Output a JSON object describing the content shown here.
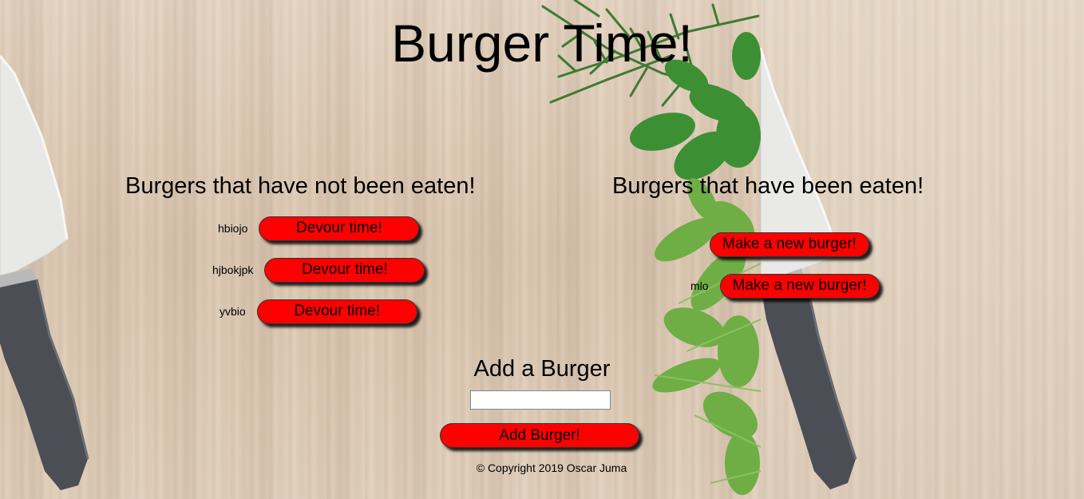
{
  "page": {
    "title": "Burger Time!"
  },
  "uneaten": {
    "heading": "Burgers that have not been eaten!",
    "items": [
      {
        "name": "hbiojo",
        "button": "Devour time!"
      },
      {
        "name": "hjbokjpk",
        "button": "Devour time!"
      },
      {
        "name": "yvbio",
        "button": "Devour time!"
      }
    ]
  },
  "eaten": {
    "heading": "Burgers that have been eaten!",
    "items": [
      {
        "name": "",
        "button": "Make a new burger!"
      },
      {
        "name": "mlo",
        "button": "Make a new burger!"
      }
    ]
  },
  "add_form": {
    "heading": "Add a Burger",
    "input_value": "",
    "submit_label": "Add Burger!"
  },
  "footer": {
    "text": "© Copyright 2019 Oscar Juma"
  },
  "colors": {
    "button": "#ff0000",
    "text": "#000000"
  },
  "icons": {
    "background": "wood-board-with-knives-and-herbs"
  }
}
